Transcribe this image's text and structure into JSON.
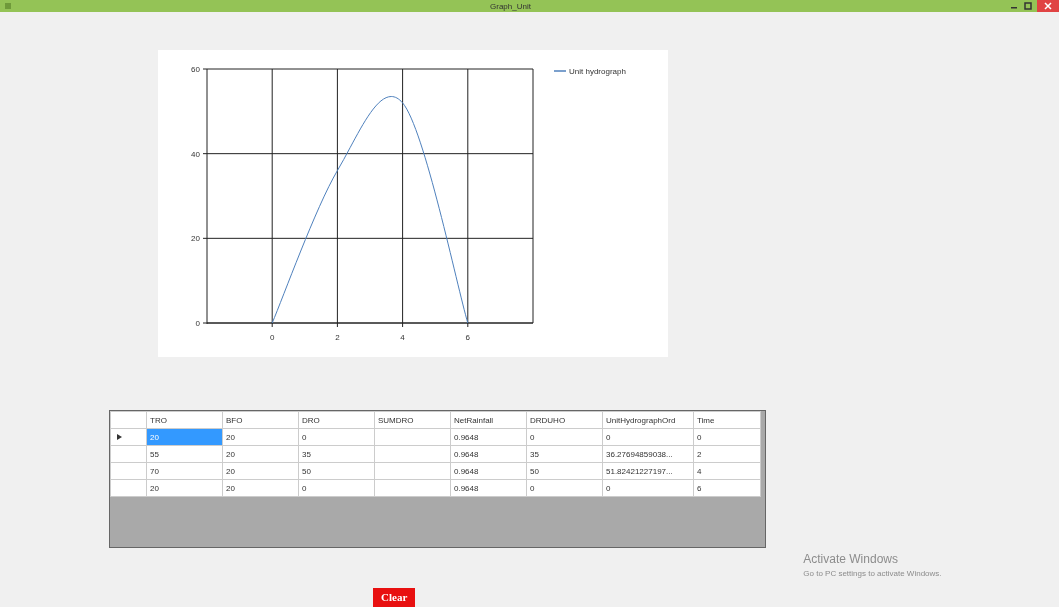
{
  "window": {
    "title": "Graph_Unit"
  },
  "chart": {
    "chart_data": {
      "type": "line",
      "x": [
        0,
        2,
        4,
        6
      ],
      "series": [
        {
          "name": "Unit hydrograph",
          "color": "#4f81bd",
          "values": [
            0,
            36,
            52,
            0
          ]
        }
      ],
      "xlim": [
        -2,
        8
      ],
      "ylim": [
        0,
        60
      ],
      "xticks": [
        0,
        2,
        4,
        6
      ],
      "yticks": [
        0,
        20,
        40,
        60
      ],
      "grid": true
    }
  },
  "table": {
    "columns": [
      "TRO",
      "BFO",
      "DRO",
      "SUMDRO",
      "NetRainfall",
      "DRDUHO",
      "UnitHydrographOrd",
      "Time"
    ],
    "rows": [
      {
        "selected": true,
        "cells": [
          "20",
          "20",
          "0",
          "",
          "0.9648",
          "0",
          "0",
          "0"
        ]
      },
      {
        "selected": false,
        "cells": [
          "55",
          "20",
          "35",
          "",
          "0.9648",
          "35",
          "36.27694859038...",
          "2"
        ]
      },
      {
        "selected": false,
        "cells": [
          "70",
          "20",
          "50",
          "",
          "0.9648",
          "50",
          "51.82421227197...",
          "4"
        ]
      },
      {
        "selected": false,
        "cells": [
          "20",
          "20",
          "0",
          "",
          "0.9648",
          "0",
          "0",
          "6"
        ]
      }
    ]
  },
  "activation": {
    "title": "Activate Windows",
    "hint": "Go to PC settings to activate Windows."
  },
  "buttons": {
    "clear": "Clear"
  }
}
